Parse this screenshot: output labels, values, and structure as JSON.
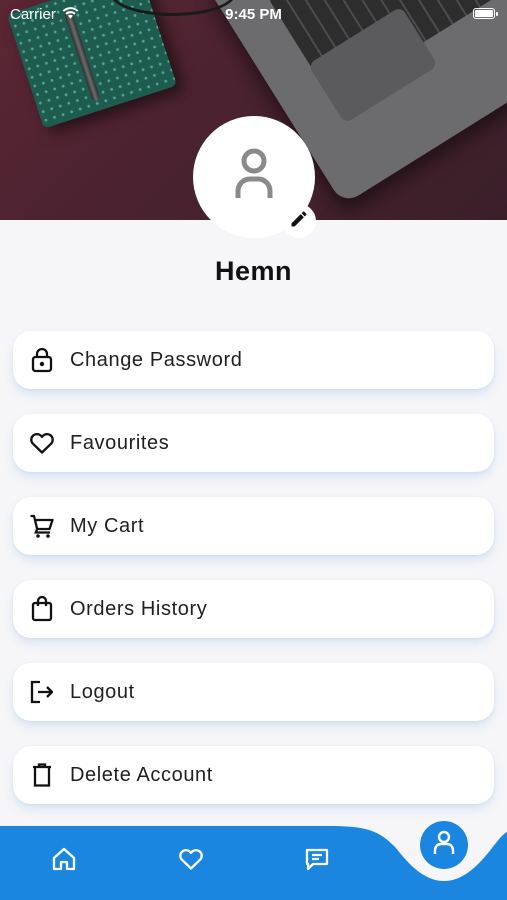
{
  "status_bar": {
    "carrier": "Carrier",
    "time": "9:45 PM",
    "wifi_icon": "wifi-icon",
    "battery_level": 1.0
  },
  "profile": {
    "username": "Hemn",
    "avatar_icon": "person-icon",
    "edit_icon": "pencil-icon"
  },
  "menu": {
    "items": [
      {
        "label": "Change Password",
        "icon": "lock-icon"
      },
      {
        "label": "Favourites",
        "icon": "heart-icon"
      },
      {
        "label": "My Cart",
        "icon": "cart-icon"
      },
      {
        "label": "Orders History",
        "icon": "bag-icon"
      },
      {
        "label": "Logout",
        "icon": "logout-icon"
      },
      {
        "label": "Delete Account",
        "icon": "trash-icon"
      }
    ]
  },
  "bottom_nav": {
    "items": [
      {
        "icon": "home-icon"
      },
      {
        "icon": "heart-icon"
      },
      {
        "icon": "chat-icon"
      },
      {
        "icon": "profile-icon",
        "active": true
      }
    ]
  },
  "colors": {
    "accent": "#1a86e0",
    "background": "#f6f6f8",
    "card": "#ffffff",
    "text": "#1f1f1f"
  }
}
